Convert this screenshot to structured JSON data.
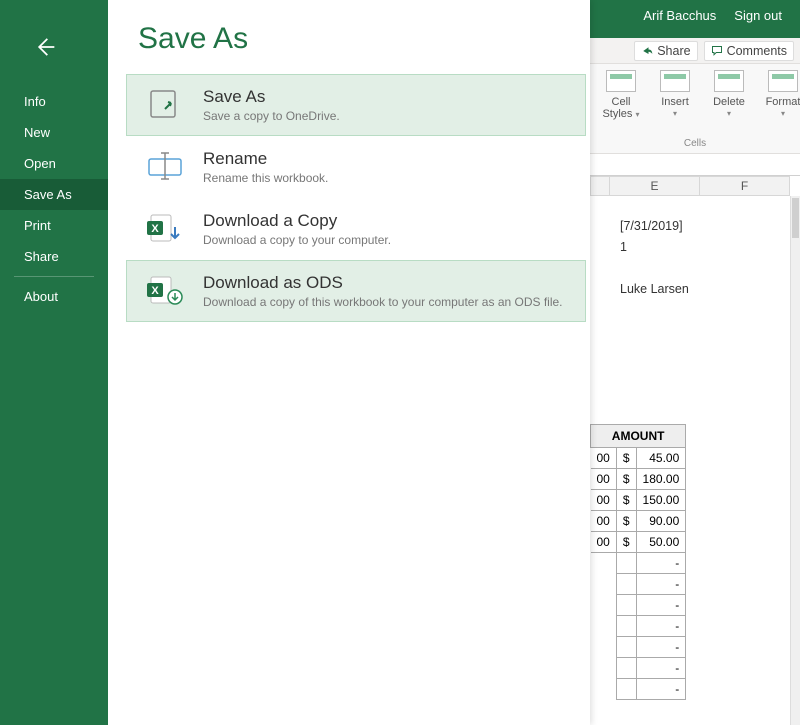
{
  "user": {
    "name": "Arif Bacchus",
    "signout": "Sign out"
  },
  "ribbon": {
    "share": "Share",
    "comments": "Comments",
    "group_label": "Cells",
    "items": [
      {
        "label": "Cell Styles"
      },
      {
        "label": "Insert"
      },
      {
        "label": "Delete"
      },
      {
        "label": "Format"
      }
    ]
  },
  "columns": [
    "E",
    "F"
  ],
  "sheet": {
    "date": "[7/31/2019]",
    "one": "1",
    "name": "Luke Larsen"
  },
  "amount": {
    "header": "AMOUNT",
    "currency": "$",
    "left_hint": "00",
    "rows": [
      "45.00",
      "180.00",
      "150.00",
      "90.00",
      "50.00"
    ],
    "dashrows": [
      "-",
      "-",
      "-",
      "-",
      "-",
      "-",
      "-"
    ]
  },
  "backstage": {
    "title": "Save As",
    "nav": {
      "items": [
        "Info",
        "New",
        "Open",
        "Save As",
        "Print",
        "Share"
      ],
      "about": "About",
      "active": "Save As"
    },
    "options": [
      {
        "title": "Save As",
        "desc": "Save a copy to OneDrive.",
        "icon": "saveas",
        "highlight": true
      },
      {
        "title": "Rename",
        "desc": "Rename this workbook.",
        "icon": "rename",
        "highlight": false
      },
      {
        "title": "Download a Copy",
        "desc": "Download a copy to your computer.",
        "icon": "excel-down",
        "highlight": false
      },
      {
        "title": "Download as ODS",
        "desc": "Download a copy of this workbook to your computer as an ODS file.",
        "icon": "excel-ods",
        "highlight": true
      }
    ]
  }
}
